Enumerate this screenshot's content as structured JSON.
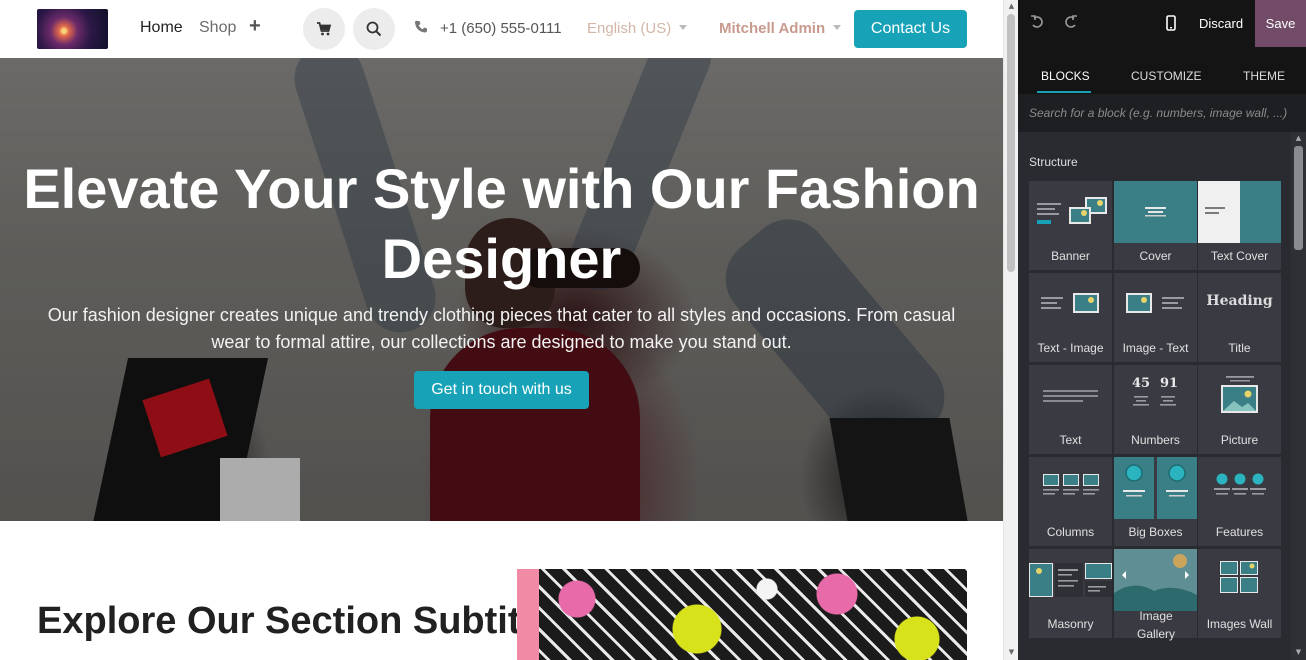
{
  "site": {
    "nav": {
      "home": "Home",
      "shop": "Shop",
      "phone": "+1 (650) 555-0111",
      "language": "English (US)",
      "user": "Mitchell Admin",
      "contact": "Contact Us"
    },
    "hero": {
      "title": "Elevate Your Style with Our Fashion Designer",
      "subtitle": "Our fashion designer creates unique and trendy clothing pieces that cater to all styles and occasions. From casual wear to formal attire, our collections are designed to make you stand out.",
      "cta": "Get in touch with us"
    },
    "section2": {
      "title": "Explore Our Section Subtitle"
    }
  },
  "editor": {
    "discard": "Discard",
    "save": "Save",
    "tabs": [
      "BLOCKS",
      "CUSTOMIZE",
      "THEME"
    ],
    "search_placeholder": "Search for a block (e.g. numbers, image wall, ...)",
    "section": "Structure",
    "blocks": [
      {
        "label": "Banner",
        "icon": "banner-icon"
      },
      {
        "label": "Cover",
        "icon": "cover-icon"
      },
      {
        "label": "Text Cover",
        "icon": "text-cover-icon"
      },
      {
        "label": "Text - Image",
        "icon": "text-image-icon"
      },
      {
        "label": "Image - Text",
        "icon": "image-text-icon"
      },
      {
        "label": "Title",
        "icon": "title-icon",
        "preview_text": "Heading"
      },
      {
        "label": "Text",
        "icon": "text-icon"
      },
      {
        "label": "Numbers",
        "icon": "numbers-icon",
        "preview_values": [
          "45",
          "91"
        ]
      },
      {
        "label": "Picture",
        "icon": "picture-icon"
      },
      {
        "label": "Columns",
        "icon": "columns-icon"
      },
      {
        "label": "Big Boxes",
        "icon": "big-boxes-icon"
      },
      {
        "label": "Features",
        "icon": "features-icon"
      },
      {
        "label": "Masonry",
        "icon": "masonry-icon"
      },
      {
        "label": "Image Gallery",
        "icon": "image-gallery-icon"
      },
      {
        "label": "Images Wall",
        "icon": "images-wall-icon"
      }
    ]
  },
  "colors": {
    "primary": "#17a2b8",
    "save": "#714b67",
    "editor_bg": "#2a2b31",
    "editor_top": "#141414",
    "block_teal": "#3b7f86"
  }
}
